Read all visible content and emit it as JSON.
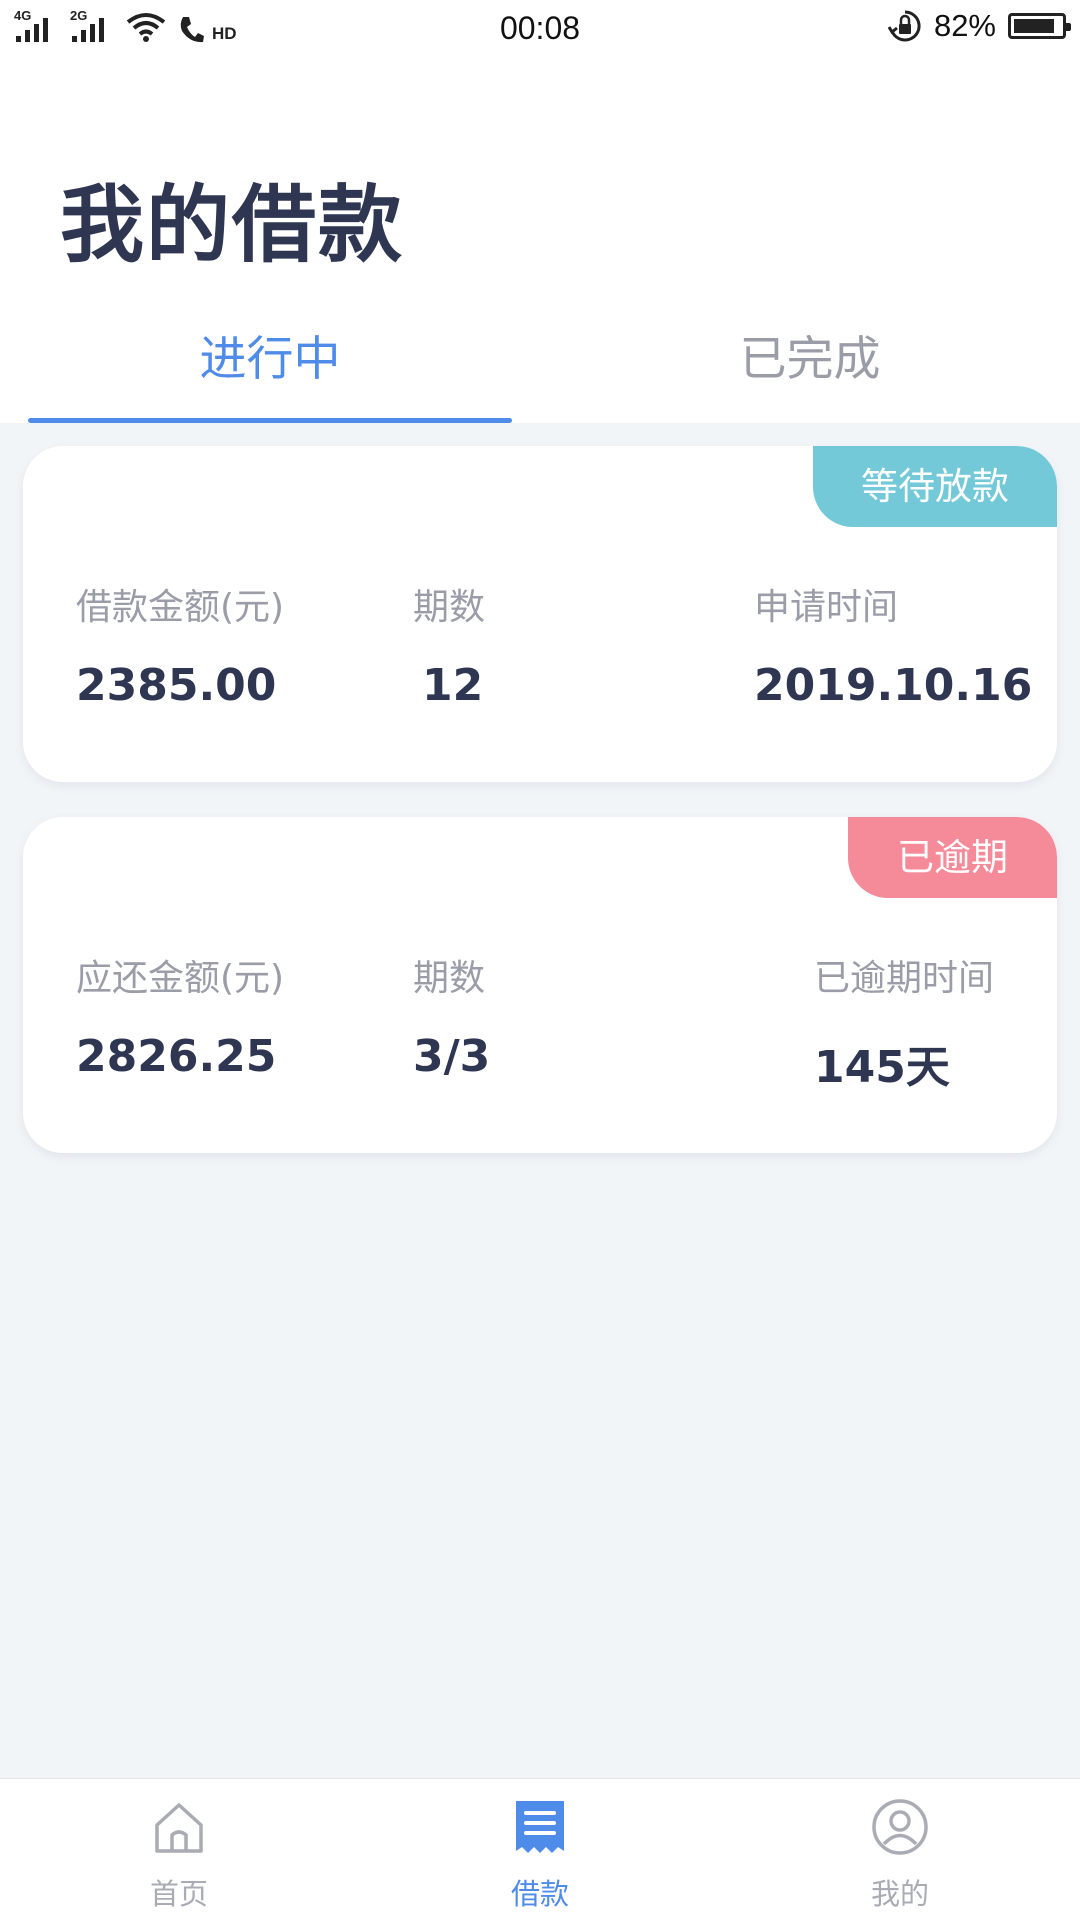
{
  "status_bar": {
    "network1": "4G",
    "network2": "2G",
    "hd": "HD",
    "time": "00:08",
    "battery": "82%"
  },
  "page": {
    "title": "我的借款"
  },
  "tabs": [
    {
      "label": "进行中",
      "active": true
    },
    {
      "label": "已完成",
      "active": false
    }
  ],
  "cards": [
    {
      "badge": "等待放款",
      "badge_color": "#74c9d9",
      "amount_label": "借款金额(元)",
      "amount": "2385.00",
      "periods_label": "期数",
      "periods": "12",
      "time_label": "申请时间",
      "time": "2019.10.16"
    },
    {
      "badge": "已逾期",
      "badge_color": "#f58b98",
      "amount_label": "应还金额(元)",
      "amount": "2826.25",
      "periods_label": "期数",
      "periods": "3/3",
      "time_label": "已逾期时间",
      "time": "145天"
    }
  ],
  "bottom_nav": [
    {
      "label": "首页",
      "icon": "home-icon",
      "active": false
    },
    {
      "label": "借款",
      "icon": "loan-document-icon",
      "active": true
    },
    {
      "label": "我的",
      "icon": "user-profile-icon",
      "active": false
    }
  ],
  "colors": {
    "accent": "#4f8be8",
    "title": "#2f3652",
    "background": "#f2f5f8"
  }
}
